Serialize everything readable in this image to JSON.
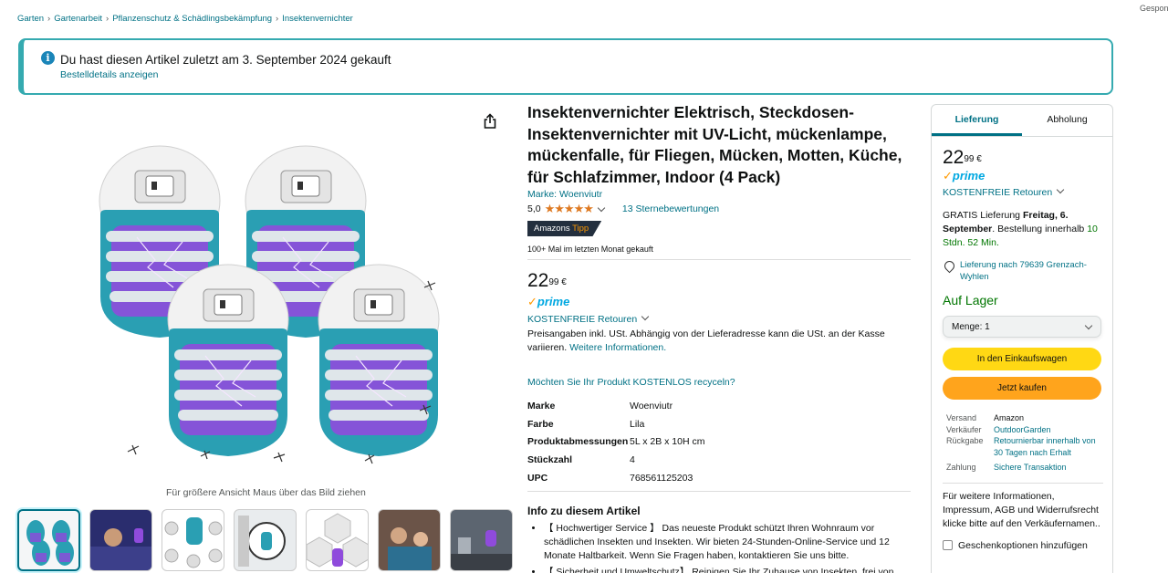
{
  "breadcrumb": [
    "Garten",
    "Gartenarbeit",
    "Pflanzenschutz & Schädlingsbekämpfung",
    "Insektenvernichter"
  ],
  "breadcrumb_separator": "›",
  "sponsored_label": "Gespons",
  "notice": {
    "title": "Du hast diesen Artikel zuletzt am 3. September 2024 gekauft",
    "link": "Bestelldetails anzeigen",
    "icon": "info-icon"
  },
  "gallery": {
    "zoom_hint": "Für größere Ansicht Maus über das Bild ziehen",
    "share_icon": "share-icon"
  },
  "product": {
    "title": "Insektenvernichter Elektrisch, Steckdosen-Insektenvernichter mit UV-Licht, mückenlampe, mückenfalle, für Fliegen, Mücken, Motten, Küche, für Schlafzimmer, Indoor (4 Pack)",
    "brand_link": "Marke: Woenviutr",
    "rating_value": "5,0",
    "rating_stars": 5.0,
    "ratings_count": "13 Sternebewertungen",
    "badge_main": "Amazons",
    "badge_accent": "Tipp",
    "bought_text": "100+ Mal im letzten Monat gekauft",
    "price_whole": "22",
    "price_fraction": "99",
    "currency": "€",
    "prime_label": "prime",
    "free_returns": "KOSTENFREIE Retouren",
    "tax_note": "Preisangaben inkl. USt. Abhängig von der Lieferadresse kann die USt. an der Kasse variieren.",
    "tax_link": "Weitere Informationen.",
    "recycle_link": "Möchten Sie Ihr Produkt KOSTENLOS recyceln?",
    "specs": [
      {
        "key": "Marke",
        "value": "Woenviutr"
      },
      {
        "key": "Farbe",
        "value": "Lila"
      },
      {
        "key": "Produktabmessungen",
        "value": "5L x 2B x 10H cm"
      },
      {
        "key": "Stückzahl",
        "value": "4"
      },
      {
        "key": "UPC",
        "value": "768561125203"
      }
    ],
    "about_title": "Info zu diesem Artikel",
    "bullets": [
      "【 Hochwertiger Service 】 Das neueste Produkt schützt Ihren Wohnraum vor schädlichen Insekten und Insekten. Wir bieten 24-Stunden-Online-Service und 12 Monate Haltbarkeit. Wenn Sie Fragen haben, kontaktieren Sie uns bitte.",
      "【 Sicherheit und Umweltschutz】 Reinigen Sie Ihr Zuhause von Insekten, frei von"
    ]
  },
  "buybox": {
    "tab_delivery": "Lieferung",
    "tab_pickup": "Abholung",
    "price_whole": "22",
    "price_fraction": "99",
    "currency": "€",
    "prime_label": "prime",
    "free_returns": "KOSTENFREIE Retouren",
    "delivery_prefix": "GRATIS Lieferung",
    "delivery_date": "Freitag, 6. September",
    "delivery_mid": ". Bestellung innerhalb",
    "delivery_countdown": "10 Stdn. 52 Min.",
    "location": "Lieferung nach 79639 Grenzach-Wyhlen",
    "stock": "Auf Lager",
    "qty_label": "Menge:",
    "qty_value": "1",
    "add_to_cart": "In den Einkaufswagen",
    "buy_now": "Jetzt kaufen",
    "info": [
      {
        "key": "Versand",
        "value": "Amazon",
        "link": false
      },
      {
        "key": "Verkäufer",
        "value": "OutdoorGarden",
        "link": true
      },
      {
        "key": "Rückgabe",
        "value": "Retournierbar innerhalb von 30 Tagen nach Erhalt",
        "link": true
      },
      {
        "key": "Zahlung",
        "value": "Sichere Transaktion",
        "link": true
      }
    ],
    "seller_info": "Für weitere Informationen, Impressum, AGB und Widerrufsrecht klicke bitte auf den Verkäufernamen..",
    "gift_option": "Geschenkoptionen hinzufügen"
  },
  "colors": {
    "link": "#007185",
    "notice_border": "#35aab0",
    "cart_button": "#ffd814",
    "buy_button": "#ffa41c",
    "stock_green": "#007600",
    "prime_blue": "#00a8e1",
    "star": "#de7921",
    "product_teal": "#2a9fb3",
    "uv_purple": "#8f4bdc"
  }
}
